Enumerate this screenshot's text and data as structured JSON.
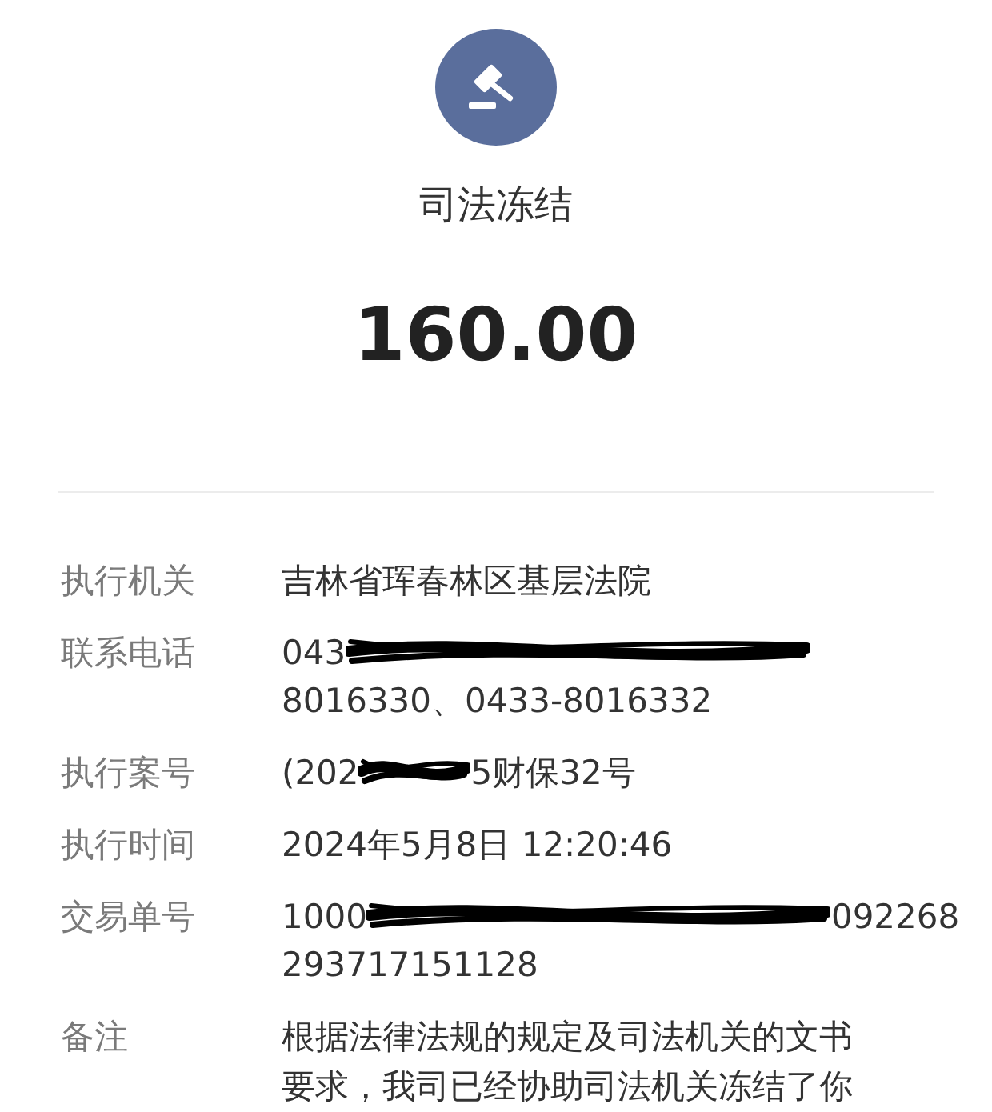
{
  "header": {
    "title": "司法冻结",
    "amount": "160.00"
  },
  "rows": [
    {
      "label": "执行机关",
      "lines": [
        [
          {
            "kind": "text",
            "text": "吉林省珲春林区基层法院"
          }
        ]
      ]
    },
    {
      "label": "联系电话",
      "lines": [
        [
          {
            "kind": "text",
            "text": "043"
          },
          {
            "kind": "scrawl"
          }
        ],
        [
          {
            "kind": "text",
            "text": "8016330、0433-8016332"
          }
        ]
      ]
    },
    {
      "label": "执行案号",
      "lines": [
        [
          {
            "kind": "text",
            "text": "(202"
          },
          {
            "kind": "scribble"
          },
          {
            "kind": "text",
            "text": "5财保32号"
          }
        ]
      ]
    },
    {
      "label": "执行时间",
      "lines": [
        [
          {
            "kind": "text",
            "text": "2024年5月8日 12:20:46"
          }
        ]
      ]
    },
    {
      "label": "交易单号",
      "lines": [
        [
          {
            "kind": "text",
            "text": "1000"
          },
          {
            "kind": "scrawl"
          },
          {
            "kind": "text",
            "text": "092268"
          }
        ],
        [
          {
            "kind": "text",
            "text": "293717151128"
          }
        ]
      ]
    },
    {
      "label": "备注",
      "lines": [
        [
          {
            "kind": "paragraph",
            "text": "根据法律法规的规定及司法机关的文书要求，我司已经协助司法机关冻结了你"
          }
        ]
      ]
    }
  ]
}
